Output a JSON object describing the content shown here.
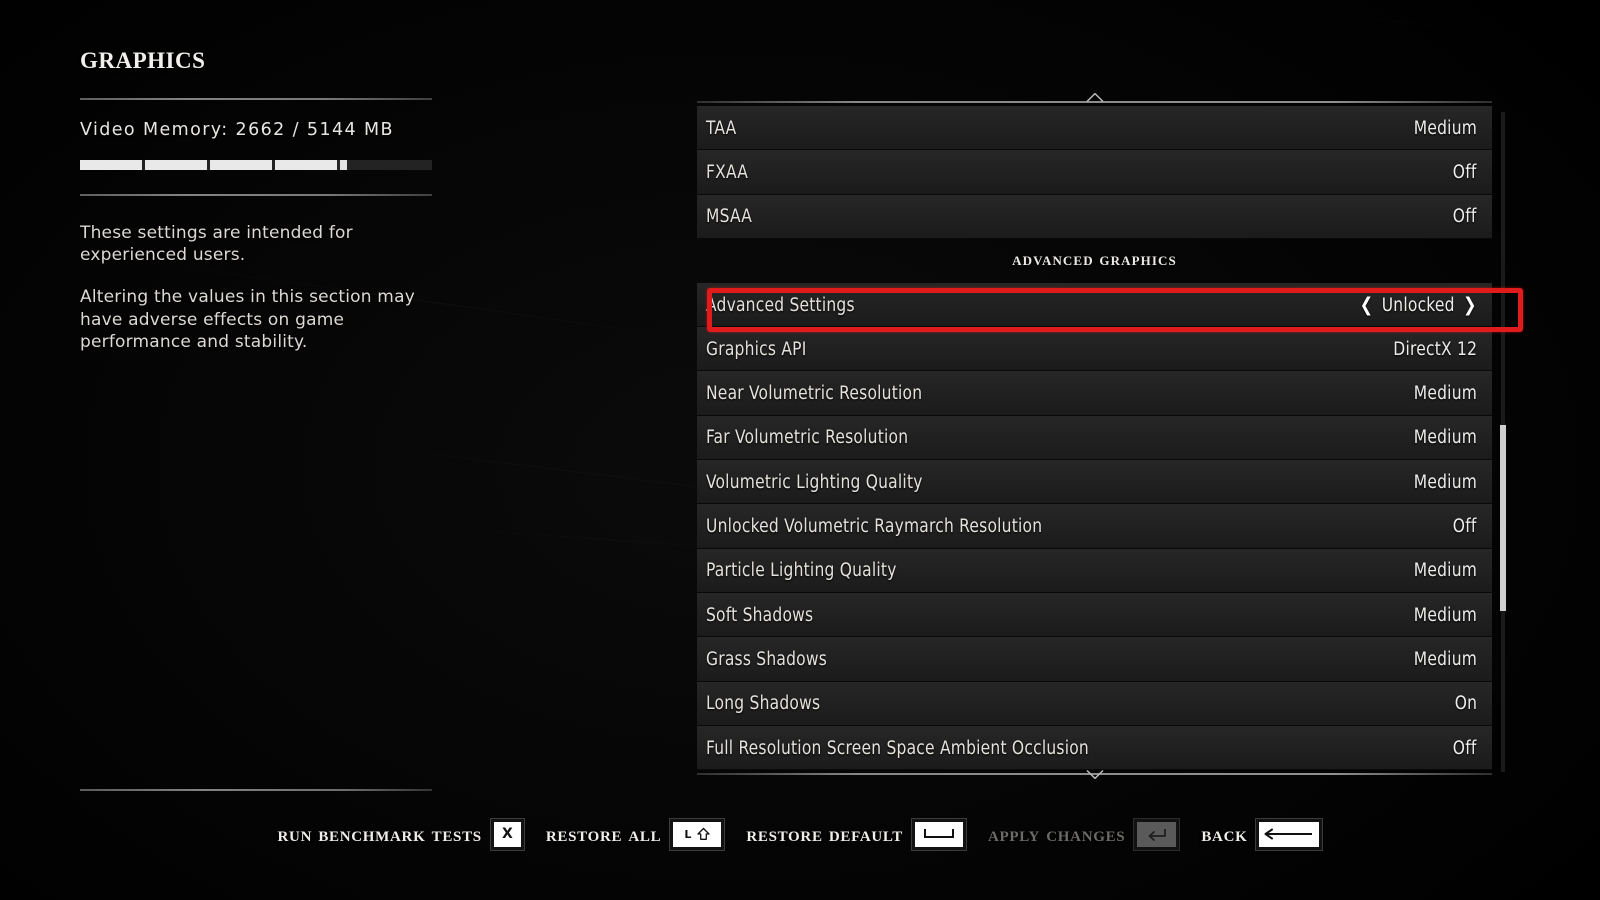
{
  "page": {
    "title": "Graphics"
  },
  "video_memory": {
    "label": "Video Memory:  2662  /  5144  MB",
    "used_mb": 2662,
    "total_mb": 5144,
    "bar_segments_filled": 4,
    "bar_partial_segment": true
  },
  "description": {
    "paragraph1": "These settings are intended for experienced users.",
    "paragraph2": "Altering the values in this section may have adverse effects on game performance and stability."
  },
  "settings": {
    "top_rows": [
      {
        "label": "TAA",
        "value": "Medium"
      },
      {
        "label": "FXAA",
        "value": "Off"
      },
      {
        "label": "MSAA",
        "value": "Off"
      }
    ],
    "section_header": "Advanced Graphics",
    "advanced_rows": [
      {
        "label": "Advanced Settings",
        "value": "Unlocked",
        "selected": true,
        "left_arrow": "❮",
        "right_arrow": "❯"
      },
      {
        "label": "Graphics API",
        "value": "DirectX 12"
      },
      {
        "label": "Near Volumetric Resolution",
        "value": "Medium"
      },
      {
        "label": "Far Volumetric Resolution",
        "value": "Medium"
      },
      {
        "label": "Volumetric Lighting Quality",
        "value": "Medium"
      },
      {
        "label": "Unlocked Volumetric Raymarch Resolution",
        "value": "Off"
      },
      {
        "label": "Particle Lighting Quality",
        "value": "Medium"
      },
      {
        "label": "Soft Shadows",
        "value": "Medium"
      },
      {
        "label": "Grass Shadows",
        "value": "Medium"
      },
      {
        "label": "Long Shadows",
        "value": "On"
      },
      {
        "label": "Full Resolution Screen Space Ambient Occlusion",
        "value": "Off"
      }
    ]
  },
  "actions": [
    {
      "label": "Run Benchmark Tests",
      "key": "X",
      "key_icon": "letter-x",
      "disabled": false
    },
    {
      "label": "Restore All",
      "key": "L ⇧",
      "key_icon": "left-shift",
      "disabled": false
    },
    {
      "label": "Restore Default",
      "key": "",
      "key_icon": "spacebar",
      "disabled": false
    },
    {
      "label": "Apply Changes",
      "key": "",
      "key_icon": "enter",
      "disabled": true
    },
    {
      "label": "Back",
      "key": "",
      "key_icon": "backspace",
      "disabled": false
    }
  ],
  "colors": {
    "annotation_red": "#e01b1b",
    "row_background": "#232323",
    "text_primary": "#e8e6e2",
    "text_disabled": "#6d6b68"
  }
}
